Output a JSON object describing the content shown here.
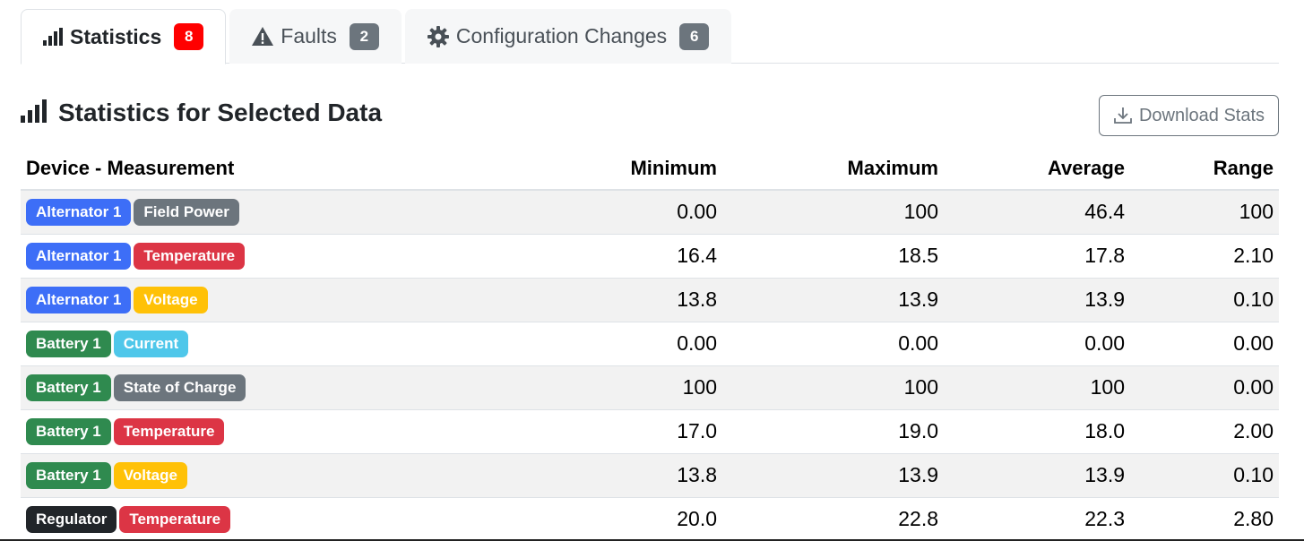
{
  "tabs": [
    {
      "label": "Statistics",
      "count": "8",
      "icon": "bar-chart-icon",
      "active": true,
      "count_color": "red"
    },
    {
      "label": "Faults",
      "count": "2",
      "icon": "warning-icon",
      "active": false,
      "count_color": "gray"
    },
    {
      "label": "Configuration Changes",
      "count": "6",
      "icon": "gear-icon",
      "active": false,
      "count_color": "gray"
    }
  ],
  "section": {
    "title": "Statistics for Selected Data",
    "icon": "bar-chart-icon",
    "download_label": "Download Stats",
    "download_icon": "download-icon"
  },
  "table": {
    "headers": [
      "Device - Measurement",
      "Minimum",
      "Maximum",
      "Average",
      "Range"
    ],
    "colors": {
      "device_alternator": "#3d6ef7",
      "device_battery": "#2f8a4f",
      "device_regulator": "#212529",
      "meas_gray": "#6c757d",
      "meas_red": "#dc3545",
      "meas_yellow": "#ffc107",
      "meas_cyan": "#4fc7ea"
    },
    "rows": [
      {
        "device": "Alternator 1",
        "device_color": "device_alternator",
        "measurement": "Field Power",
        "measurement_color": "meas_gray",
        "min": "0.00",
        "max": "100",
        "avg": "46.4",
        "range": "100"
      },
      {
        "device": "Alternator 1",
        "device_color": "device_alternator",
        "measurement": "Temperature",
        "measurement_color": "meas_red",
        "min": "16.4",
        "max": "18.5",
        "avg": "17.8",
        "range": "2.10"
      },
      {
        "device": "Alternator 1",
        "device_color": "device_alternator",
        "measurement": "Voltage",
        "measurement_color": "meas_yellow",
        "min": "13.8",
        "max": "13.9",
        "avg": "13.9",
        "range": "0.10"
      },
      {
        "device": "Battery 1",
        "device_color": "device_battery",
        "measurement": "Current",
        "measurement_color": "meas_cyan",
        "min": "0.00",
        "max": "0.00",
        "avg": "0.00",
        "range": "0.00"
      },
      {
        "device": "Battery 1",
        "device_color": "device_battery",
        "measurement": "State of Charge",
        "measurement_color": "meas_gray",
        "min": "100",
        "max": "100",
        "avg": "100",
        "range": "0.00"
      },
      {
        "device": "Battery 1",
        "device_color": "device_battery",
        "measurement": "Temperature",
        "measurement_color": "meas_red",
        "min": "17.0",
        "max": "19.0",
        "avg": "18.0",
        "range": "2.00"
      },
      {
        "device": "Battery 1",
        "device_color": "device_battery",
        "measurement": "Voltage",
        "measurement_color": "meas_yellow",
        "min": "13.8",
        "max": "13.9",
        "avg": "13.9",
        "range": "0.10"
      },
      {
        "device": "Regulator",
        "device_color": "device_regulator",
        "measurement": "Temperature",
        "measurement_color": "meas_red",
        "min": "20.0",
        "max": "22.8",
        "avg": "22.3",
        "range": "2.80"
      }
    ]
  }
}
